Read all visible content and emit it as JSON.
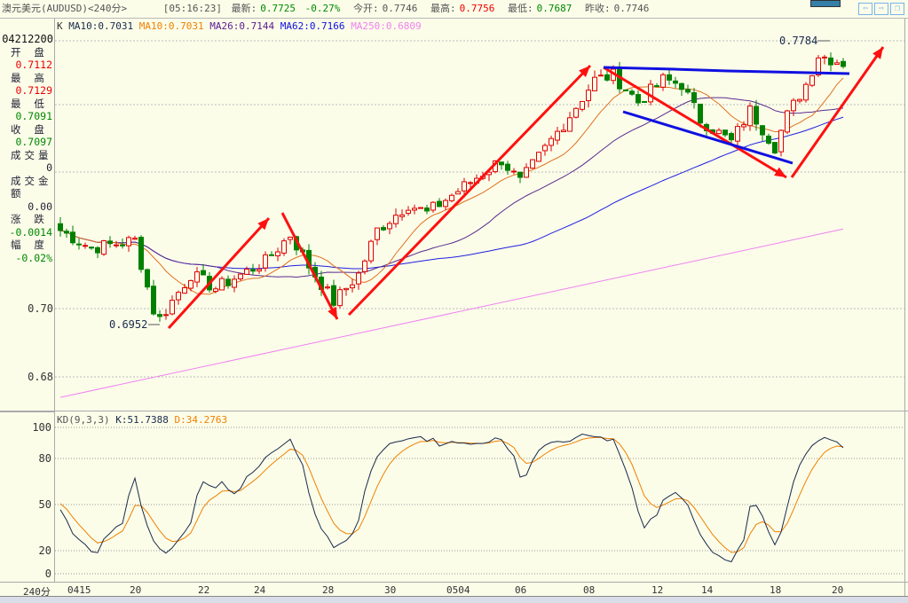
{
  "header": {
    "title": "澳元美元(AUDUSD)<240分>",
    "time": "[05:16:23]",
    "latest_label": "最新:",
    "latest": "0.7725",
    "change": "-0.27%",
    "open_label": "今开:",
    "open": "0.7746",
    "high_label": "最高:",
    "high": "0.7756",
    "low_label": "最低:",
    "low": "0.7687",
    "prev_label": "昨收:",
    "prev": "0.7746",
    "nav_icons": [
      "arrow-left-icon",
      "arrow-right-icon",
      "restore-window-icon"
    ]
  },
  "info": {
    "datetime": "04212200",
    "rows": [
      {
        "label": "开 盘",
        "value": "0.7112",
        "color": "#e00"
      },
      {
        "label": "最 高",
        "value": "0.7129",
        "color": "#e00"
      },
      {
        "label": "最 低",
        "value": "0.7091",
        "color": "#080"
      },
      {
        "label": "收 盘",
        "value": "0.7097",
        "color": "#080"
      },
      {
        "label": "成交量",
        "value": "0",
        "color": "#223"
      },
      {
        "label": "成交金额",
        "value": "0.00",
        "color": "#223"
      },
      {
        "label": "涨 跌",
        "value": "-0.0014",
        "color": "#080"
      },
      {
        "label": "幅 度",
        "value": "-0.02%",
        "color": "#080"
      }
    ]
  },
  "legend": {
    "k": "K",
    "ma1": "MA10:0.7031",
    "ma2": "MA10:0.7031",
    "ma3": "MA26:0.7144",
    "ma4": "MA62:0.7166",
    "ma5": "MA250:0.6809"
  },
  "colors": {
    "up": "#e00000",
    "down": "#008000",
    "ma10": "#e07020",
    "ma26": "#5a2a90",
    "ma62": "#2020e0",
    "ma250": "#f080f0",
    "k": "#1a2a4a",
    "d": "#f08000",
    "annot_red": "#ff1010",
    "annot_blue": "#1010e0"
  },
  "chart_data": {
    "type": "candlestick",
    "price_ticks": [
      "0.70",
      "0.68"
    ],
    "price_range": [
      0.662,
      0.782
    ],
    "max_label": "0.7784",
    "min_label": "0.6952",
    "price_path": [
      [
        0,
        0.7229
      ],
      [
        5,
        0.7177
      ],
      [
        12,
        0.72
      ],
      [
        15,
        0.6995
      ],
      [
        16,
        0.697
      ],
      [
        21,
        0.71
      ],
      [
        25,
        0.706
      ],
      [
        33,
        0.7138
      ],
      [
        37,
        0.7216
      ],
      [
        40,
        0.7125
      ],
      [
        44,
        0.702
      ],
      [
        48,
        0.71
      ],
      [
        51,
        0.723
      ],
      [
        56,
        0.7306
      ],
      [
        59,
        0.728
      ],
      [
        65,
        0.7358
      ],
      [
        71,
        0.7436
      ],
      [
        74,
        0.737
      ],
      [
        82,
        0.7566
      ],
      [
        86,
        0.767
      ],
      [
        89,
        0.7683
      ],
      [
        93,
        0.7605
      ],
      [
        97,
        0.767
      ],
      [
        100,
        0.7657
      ],
      [
        103,
        0.7553
      ],
      [
        108,
        0.7488
      ],
      [
        111,
        0.758
      ],
      [
        115,
        0.7475
      ],
      [
        117,
        0.7566
      ],
      [
        120,
        0.7657
      ],
      [
        122,
        0.7743
      ],
      [
        126,
        0.772
      ]
    ],
    "ma250_range": [
      0.674,
      0.7233
    ],
    "x_ticks": [
      "0415",
      "20",
      "22",
      "24",
      "28",
      "30",
      "0504",
      "06",
      "08",
      "12",
      "14",
      "18",
      "20"
    ],
    "x_tick_candle": [
      2,
      12,
      23,
      32,
      43,
      53,
      63,
      74,
      85,
      96,
      104,
      115,
      125
    ],
    "kd": {
      "label": "KD(9,3,3)",
      "k": "K:51.7388",
      "d": "D:34.2763",
      "ticks": [
        "100",
        "80",
        "50",
        "20",
        "0"
      ],
      "range": [
        0,
        100
      ]
    },
    "period_label": "240分"
  }
}
